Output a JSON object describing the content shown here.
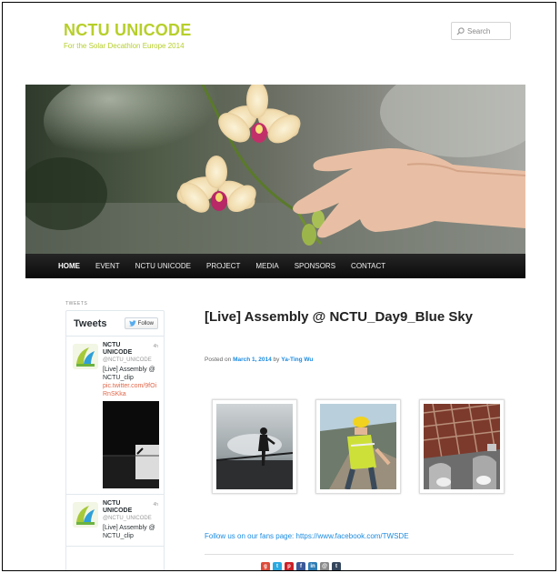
{
  "site": {
    "title": "NCTU UNICODE",
    "description": "For the Solar Decathlon Europe 2014"
  },
  "search": {
    "placeholder": "Search"
  },
  "nav": {
    "items": [
      "HOME",
      "EVENT",
      "NCTU UNICODE",
      "PROJECT",
      "MEDIA",
      "SPONSORS",
      "CONTACT"
    ],
    "active": "HOME"
  },
  "sidebar": {
    "section_label": "TWEETS",
    "widget_title": "Tweets",
    "follow_label": "Follow",
    "tweets": [
      {
        "name": "NCTU UNICODE",
        "handle": "@NCTU_UNICODE",
        "time": "4h",
        "text": "[Live] Assembly @ NCTU_clip",
        "link": "pic.twitter.com/9fOiRnSKka"
      },
      {
        "name": "NCTU UNICODE",
        "handle": "@NCTU_UNICODE",
        "time": "4h",
        "text": "[Live] Assembly @ NCTU_clip"
      }
    ]
  },
  "post": {
    "title": "[Live] Assembly @ NCTU_Day9_Blue Sky",
    "meta_prefix": "Posted on",
    "date": "March 1, 2014",
    "meta_by": "by",
    "author": "Ya-Ting Wu",
    "follow_text": "Follow us on our fans page: https://www.facebook.com/TWSDE"
  },
  "share_icons": [
    {
      "name": "google-plus-icon",
      "glyph": "g",
      "color": "#dd4b39"
    },
    {
      "name": "twitter-icon",
      "glyph": "t",
      "color": "#2aa9e0"
    },
    {
      "name": "pinterest-icon",
      "glyph": "p",
      "color": "#cb2027"
    },
    {
      "name": "facebook-icon",
      "glyph": "f",
      "color": "#3b5998"
    },
    {
      "name": "linkedin-icon",
      "glyph": "in",
      "color": "#2e7cb5"
    },
    {
      "name": "email-icon",
      "glyph": "@",
      "color": "#8a8a8a"
    },
    {
      "name": "tumblr-icon",
      "glyph": "t",
      "color": "#35465c"
    }
  ],
  "colors": {
    "brand_green": "#b7cf2a",
    "link_blue": "#1b8be0",
    "nav_bg": "#1a1a1a",
    "tweet_link": "#e0674a"
  }
}
